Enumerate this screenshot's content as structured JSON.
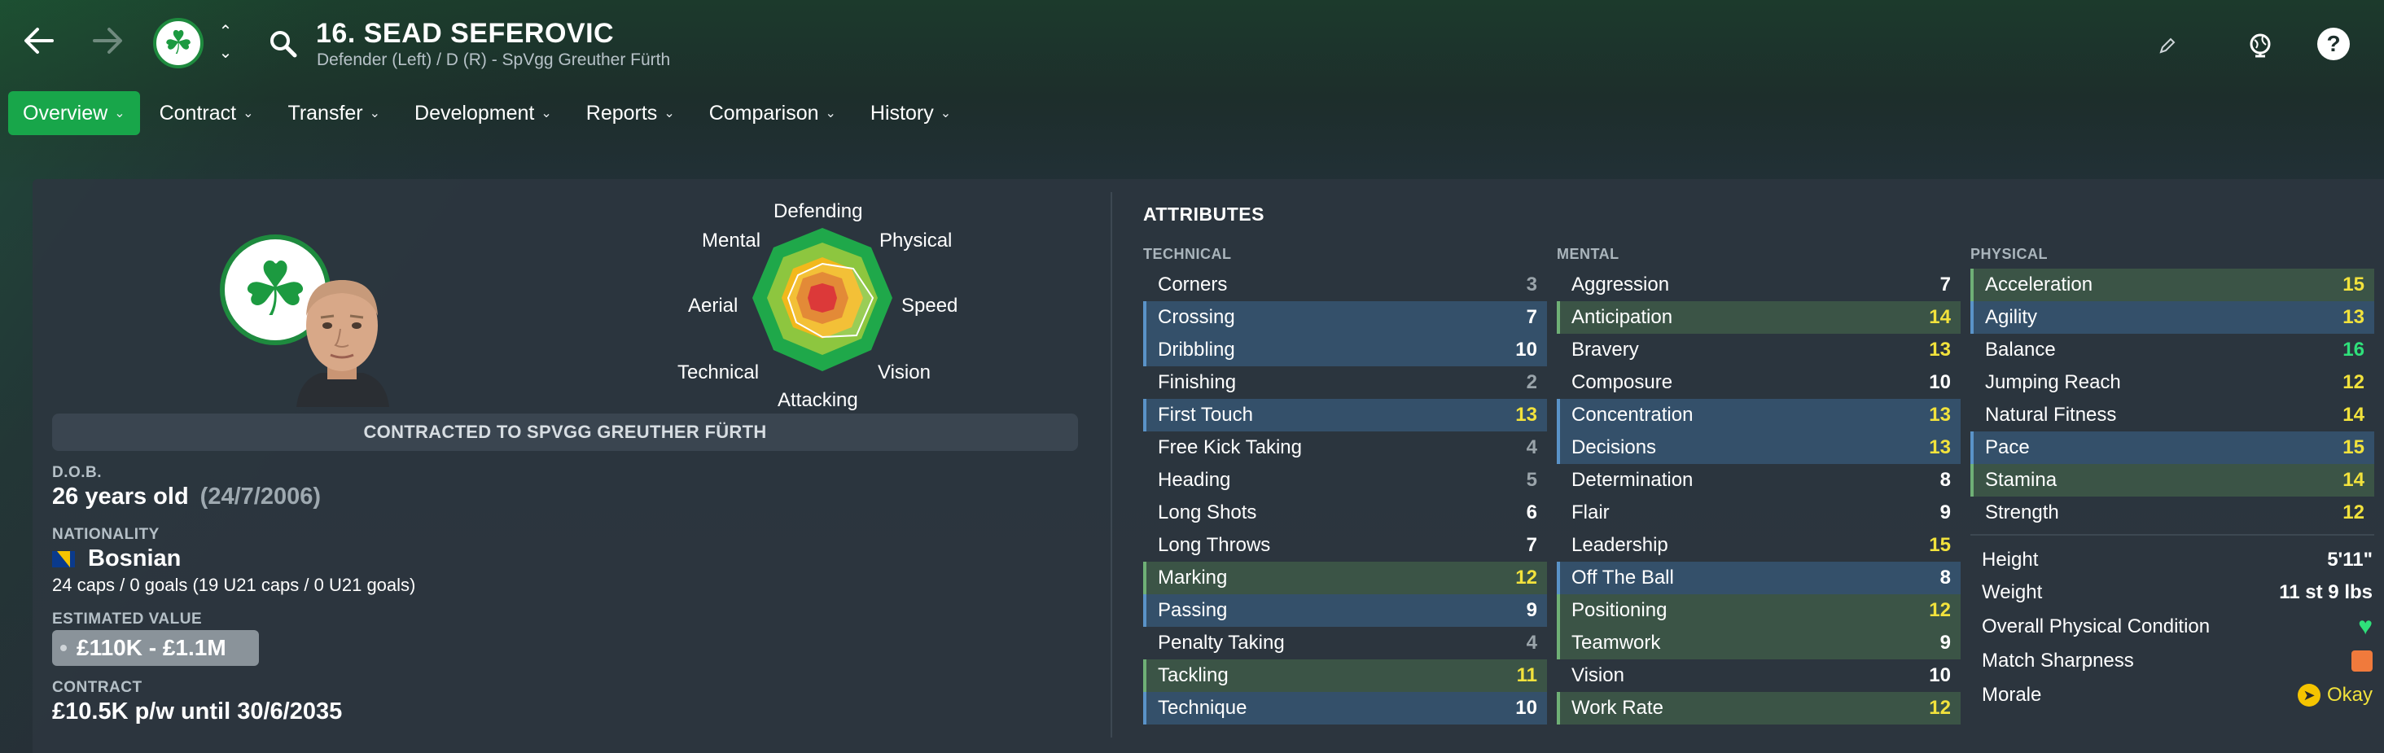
{
  "header": {
    "player_name": "16. SEAD SEFEROVIC",
    "player_subtitle": "Defender (Left) / D (R) - SpVgg Greuther Fürth"
  },
  "tabs": [
    {
      "label": "Overview",
      "active": true
    },
    {
      "label": "Contract"
    },
    {
      "label": "Transfer"
    },
    {
      "label": "Development"
    },
    {
      "label": "Reports"
    },
    {
      "label": "Comparison"
    },
    {
      "label": "History"
    }
  ],
  "overview": {
    "contract_banner": "CONTRACTED TO SPVGG GREUTHER FÜRTH",
    "dob_label": "D.O.B.",
    "dob_age": "26 years old",
    "dob_date": "(24/7/2006)",
    "nationality_label": "NATIONALITY",
    "nationality": "Bosnian",
    "caps": "24 caps / 0 goals (19 U21 caps / 0 U21 goals)",
    "value_label": "ESTIMATED VALUE",
    "value": "£110K - £1.1M",
    "contract_label": "CONTRACT",
    "contract": "£10.5K p/w until 30/6/2035"
  },
  "radar": {
    "labels": {
      "defending": "Defending",
      "physical": "Physical",
      "speed": "Speed",
      "vision": "Vision",
      "attacking": "Attacking",
      "technical": "Technical",
      "aerial": "Aerial",
      "mental": "Mental"
    }
  },
  "attributes": {
    "title": "ATTRIBUTES",
    "technical_head": "TECHNICAL",
    "mental_head": "MENTAL",
    "physical_head": "PHYSICAL",
    "technical": [
      {
        "name": "Corners",
        "value": "3",
        "hl": "",
        "color": "gray"
      },
      {
        "name": "Crossing",
        "value": "7",
        "hl": "blue",
        "color": "white"
      },
      {
        "name": "Dribbling",
        "value": "10",
        "hl": "blue",
        "color": "white"
      },
      {
        "name": "Finishing",
        "value": "2",
        "hl": "",
        "color": "gray"
      },
      {
        "name": "First Touch",
        "value": "13",
        "hl": "blue",
        "color": "yellow"
      },
      {
        "name": "Free Kick Taking",
        "value": "4",
        "hl": "",
        "color": "gray"
      },
      {
        "name": "Heading",
        "value": "5",
        "hl": "",
        "color": "gray"
      },
      {
        "name": "Long Shots",
        "value": "6",
        "hl": "",
        "color": "white"
      },
      {
        "name": "Long Throws",
        "value": "7",
        "hl": "",
        "color": "white"
      },
      {
        "name": "Marking",
        "value": "12",
        "hl": "green",
        "color": "yellow"
      },
      {
        "name": "Passing",
        "value": "9",
        "hl": "blue",
        "color": "white"
      },
      {
        "name": "Penalty Taking",
        "value": "4",
        "hl": "",
        "color": "gray"
      },
      {
        "name": "Tackling",
        "value": "11",
        "hl": "green",
        "color": "yellow"
      },
      {
        "name": "Technique",
        "value": "10",
        "hl": "blue",
        "color": "white"
      }
    ],
    "mental": [
      {
        "name": "Aggression",
        "value": "7",
        "hl": "",
        "color": "white"
      },
      {
        "name": "Anticipation",
        "value": "14",
        "hl": "green",
        "color": "yellow"
      },
      {
        "name": "Bravery",
        "value": "13",
        "hl": "",
        "color": "yellow"
      },
      {
        "name": "Composure",
        "value": "10",
        "hl": "",
        "color": "white"
      },
      {
        "name": "Concentration",
        "value": "13",
        "hl": "blue",
        "color": "yellow"
      },
      {
        "name": "Decisions",
        "value": "13",
        "hl": "blue",
        "color": "yellow"
      },
      {
        "name": "Determination",
        "value": "8",
        "hl": "",
        "color": "white"
      },
      {
        "name": "Flair",
        "value": "9",
        "hl": "",
        "color": "white"
      },
      {
        "name": "Leadership",
        "value": "15",
        "hl": "",
        "color": "yellow"
      },
      {
        "name": "Off The Ball",
        "value": "8",
        "hl": "blue",
        "color": "white"
      },
      {
        "name": "Positioning",
        "value": "12",
        "hl": "green",
        "color": "yellow"
      },
      {
        "name": "Teamwork",
        "value": "9",
        "hl": "green",
        "color": "white"
      },
      {
        "name": "Vision",
        "value": "10",
        "hl": "",
        "color": "white"
      },
      {
        "name": "Work Rate",
        "value": "12",
        "hl": "green",
        "color": "yellow"
      }
    ],
    "physical": [
      {
        "name": "Acceleration",
        "value": "15",
        "hl": "green",
        "color": "yellow"
      },
      {
        "name": "Agility",
        "value": "13",
        "hl": "blue",
        "color": "yellow"
      },
      {
        "name": "Balance",
        "value": "16",
        "hl": "",
        "color": "green"
      },
      {
        "name": "Jumping Reach",
        "value": "12",
        "hl": "",
        "color": "yellow"
      },
      {
        "name": "Natural Fitness",
        "value": "14",
        "hl": "",
        "color": "yellow"
      },
      {
        "name": "Pace",
        "value": "15",
        "hl": "blue",
        "color": "yellow"
      },
      {
        "name": "Stamina",
        "value": "14",
        "hl": "green",
        "color": "yellow"
      },
      {
        "name": "Strength",
        "value": "12",
        "hl": "",
        "color": "yellow"
      }
    ],
    "physical_extra": {
      "height_label": "Height",
      "height": "5'11\"",
      "weight_label": "Weight",
      "weight": "11 st 9 lbs",
      "condition_label": "Overall Physical Condition",
      "sharpness_label": "Match Sharpness",
      "morale_label": "Morale",
      "morale": "Okay"
    }
  },
  "colors": {
    "accent": "#18a64a",
    "highlight_blue": "#34506a",
    "highlight_green": "#3b5446",
    "num_yellow": "#f2e23c",
    "num_green": "#2fe07a"
  },
  "icons": [
    "back-arrow-icon",
    "forward-arrow-icon",
    "club-badge-icon",
    "search-icon",
    "pencil-icon",
    "globe-icon",
    "help-icon",
    "chevron-down-icon",
    "heart-icon",
    "match-sharpness-icon",
    "morale-icon",
    "flag-icon"
  ]
}
